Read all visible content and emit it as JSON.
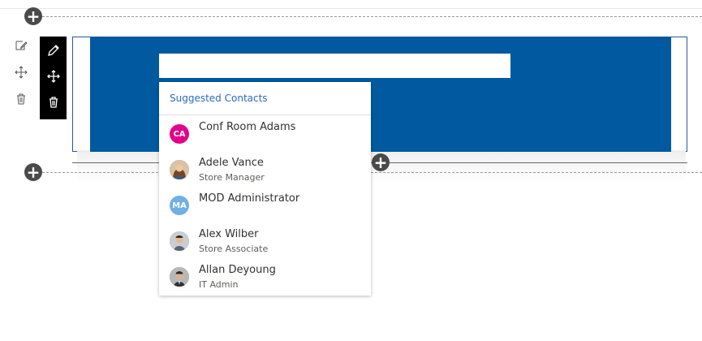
{
  "canvas": {
    "add_section_symbol": "+",
    "search": {
      "value": "",
      "placeholder": ""
    }
  },
  "suggestions": {
    "header": "Suggested Contacts",
    "contacts": [
      {
        "name": "Conf Room Adams",
        "subtitle": "",
        "initials": "CA",
        "avatar_color": "#e3008c",
        "avatar_type": "initials"
      },
      {
        "name": "Adele Vance",
        "subtitle": "Store Manager",
        "initials": "",
        "avatar_color": "#c47a4a",
        "avatar_type": "photo"
      },
      {
        "name": "MOD Administrator",
        "subtitle": "",
        "initials": "MA",
        "avatar_color": "#71afe5",
        "avatar_type": "initials"
      },
      {
        "name": "Alex Wilber",
        "subtitle": "Store Associate",
        "initials": "",
        "avatar_color": "#8a8a8a",
        "avatar_type": "photo"
      },
      {
        "name": "Allan Deyoung",
        "subtitle": "IT Admin",
        "initials": "",
        "avatar_color": "#6b6b6b",
        "avatar_type": "photo"
      }
    ]
  },
  "colors": {
    "section_background": "#0159a0",
    "section_border": "#2b5797",
    "toolbar_background": "#000000",
    "header_text": "#2b69c6"
  },
  "icons": {
    "side_toolbar": [
      "edit-icon",
      "move-icon",
      "delete-icon"
    ],
    "webpart_toolbar": [
      "pencil-icon",
      "move-icon",
      "trash-icon"
    ]
  }
}
